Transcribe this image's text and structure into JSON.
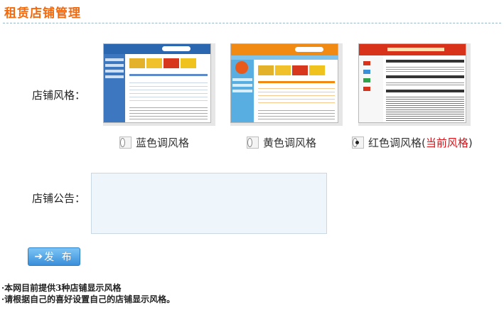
{
  "page": {
    "title": "租赁店铺管理"
  },
  "style_section": {
    "label": "店铺风格：",
    "options": [
      {
        "label": "蓝色调风格",
        "selected": false,
        "theme_color": "#2a67b0"
      },
      {
        "label": "黄色调风格",
        "selected": false,
        "theme_color": "#f08a12"
      },
      {
        "label": "红色调风格",
        "selected": true,
        "theme_color": "#d8321a",
        "current_tag": "当前风格",
        "paren_open": "(",
        "paren_close": ")"
      }
    ]
  },
  "notice_section": {
    "label": "店铺公告：",
    "value": ""
  },
  "publish_button": {
    "label": "发 布",
    "icon": "arrow-right-icon"
  },
  "tips": [
    "·本网目前提供3种店铺显示风格",
    "·请根据自己的喜好设置自己的店铺显示风格。"
  ],
  "colors": {
    "title": "#f26a0d",
    "current": "#d8141b",
    "button": "#3a8fd9"
  }
}
